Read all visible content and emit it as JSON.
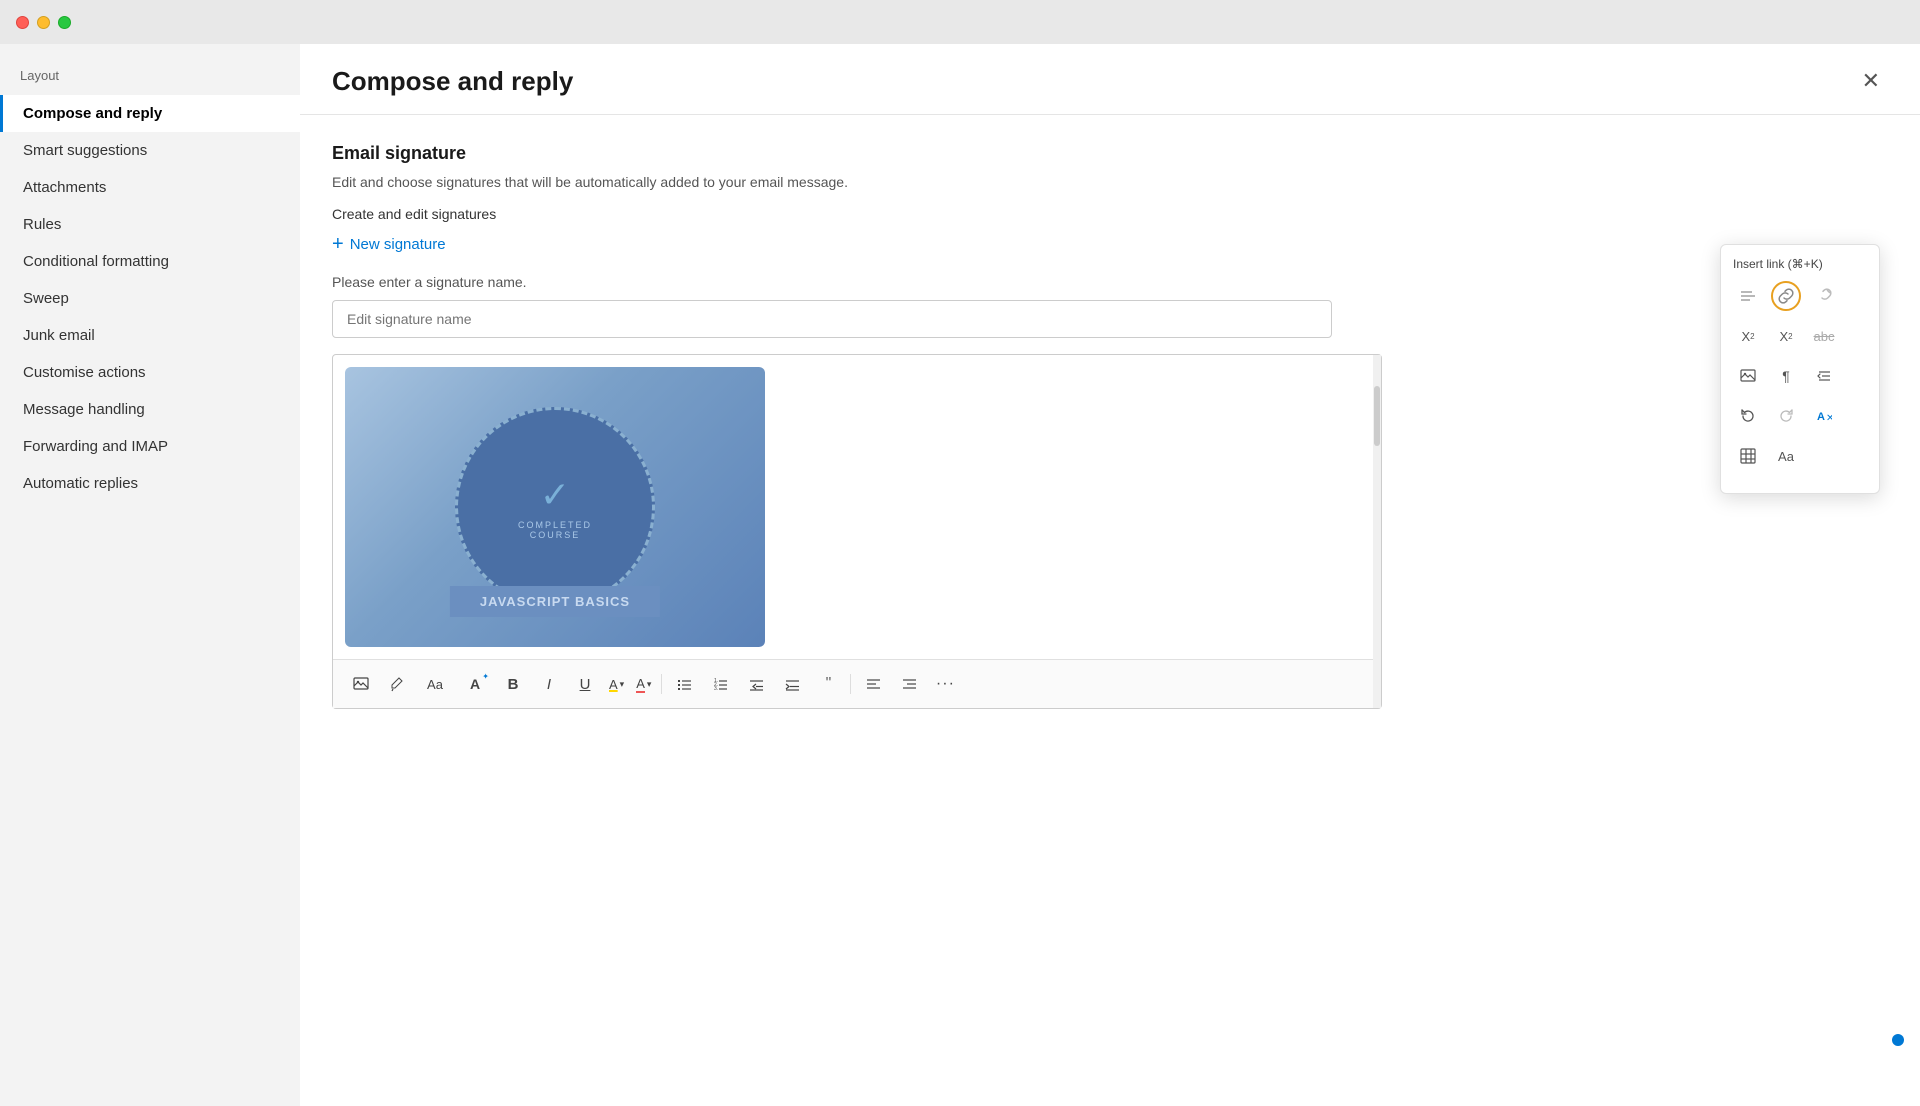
{
  "titlebar": {
    "close_label": "close",
    "minimize_label": "minimize",
    "maximize_label": "maximize"
  },
  "sidebar": {
    "group_label": "Layout",
    "items": [
      {
        "id": "compose-reply",
        "label": "Compose and reply",
        "active": true
      },
      {
        "id": "smart-suggestions",
        "label": "Smart suggestions",
        "active": false
      },
      {
        "id": "attachments",
        "label": "Attachments",
        "active": false
      },
      {
        "id": "rules",
        "label": "Rules",
        "active": false
      },
      {
        "id": "conditional-formatting",
        "label": "Conditional formatting",
        "active": false
      },
      {
        "id": "sweep",
        "label": "Sweep",
        "active": false
      },
      {
        "id": "junk-email",
        "label": "Junk email",
        "active": false
      },
      {
        "id": "customise-actions",
        "label": "Customise actions",
        "active": false
      },
      {
        "id": "message-handling",
        "label": "Message handling",
        "active": false
      },
      {
        "id": "forwarding-imap",
        "label": "Forwarding and IMAP",
        "active": false
      },
      {
        "id": "automatic-replies",
        "label": "Automatic replies",
        "active": false
      }
    ]
  },
  "panel": {
    "title": "Compose and reply",
    "close_label": "✕",
    "section": {
      "title": "Email signature",
      "description": "Edit and choose signatures that will be automatically added to your email message.",
      "create_label": "Create and edit signatures",
      "new_sig_label": "New signature",
      "enter_name_hint": "Please enter a signature name.",
      "sig_name_placeholder": "Edit signature name"
    }
  },
  "tooltip": {
    "label": "Insert link (⌘+K)"
  },
  "toolbar": {
    "buttons": [
      {
        "id": "insert-image",
        "icon": "🖼",
        "label": "Insert image"
      },
      {
        "id": "format-brush",
        "icon": "🖌",
        "label": "Format brush"
      },
      {
        "id": "font-size",
        "icon": "Aa",
        "label": "Font size"
      },
      {
        "id": "font-size-up",
        "icon": "A↑",
        "label": "Font size up"
      },
      {
        "id": "bold",
        "icon": "B",
        "label": "Bold"
      },
      {
        "id": "italic",
        "icon": "I",
        "label": "Italic"
      },
      {
        "id": "underline",
        "icon": "U",
        "label": "Underline"
      },
      {
        "id": "highlight-color",
        "icon": "A̲",
        "label": "Highlight color"
      },
      {
        "id": "font-color",
        "icon": "A",
        "label": "Font color"
      },
      {
        "id": "bullets",
        "icon": "≡",
        "label": "Bullets"
      },
      {
        "id": "numbering",
        "icon": "⋮",
        "label": "Numbering"
      },
      {
        "id": "decrease-indent",
        "icon": "←",
        "label": "Decrease indent"
      },
      {
        "id": "increase-indent",
        "icon": "→",
        "label": "Increase indent"
      },
      {
        "id": "quote",
        "icon": "❝",
        "label": "Quote"
      },
      {
        "id": "align-left",
        "icon": "≡",
        "label": "Align left"
      },
      {
        "id": "align-right",
        "icon": "≡",
        "label": "Align right"
      },
      {
        "id": "more",
        "icon": "···",
        "label": "More options"
      }
    ]
  }
}
